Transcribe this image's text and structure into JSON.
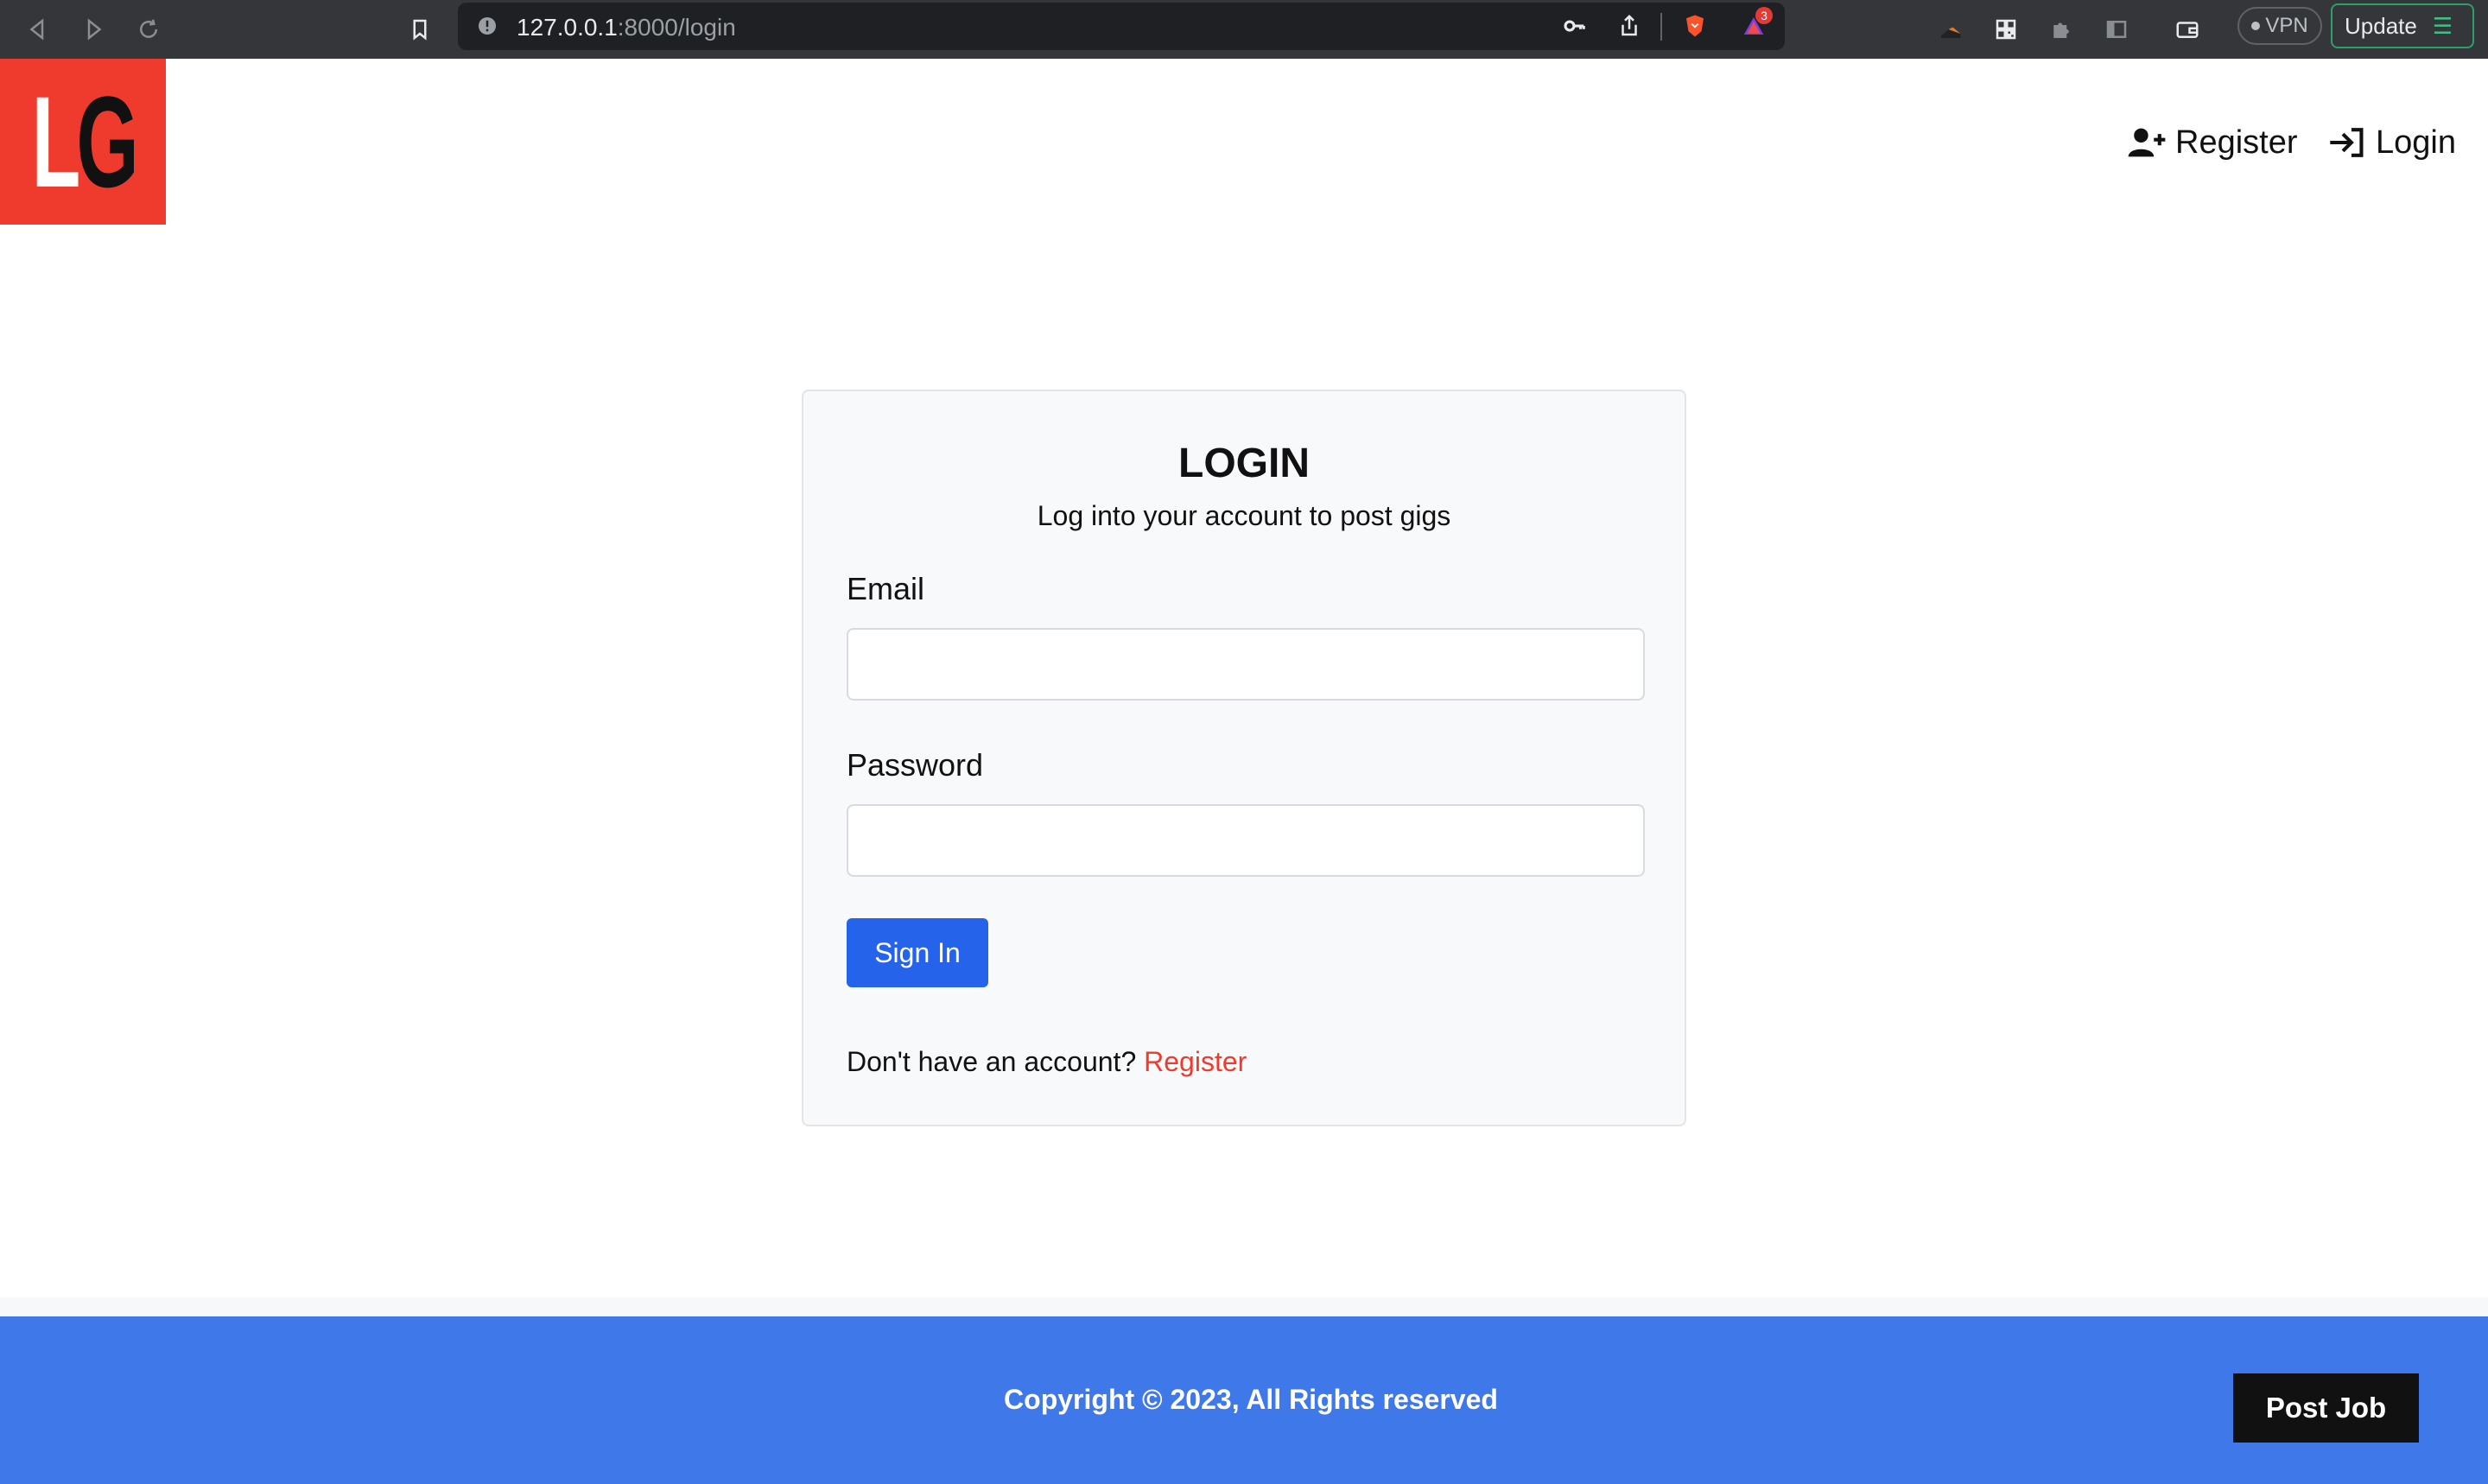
{
  "browser": {
    "url_host": "127.0.0.1",
    "url_rest": ":8000/login",
    "notification_count": "3",
    "vpn_label": "VPN",
    "update_label": "Update"
  },
  "header": {
    "logo_letters": [
      "L",
      "G"
    ],
    "nav": [
      {
        "label": "Register",
        "icon": "user-plus-icon"
      },
      {
        "label": "Login",
        "icon": "sign-in-icon"
      }
    ]
  },
  "login": {
    "title": "LOGIN",
    "subtitle": "Log into your account to post gigs",
    "email_label": "Email",
    "email_value": "",
    "password_label": "Password",
    "password_value": "",
    "submit_label": "Sign In",
    "register_prompt": "Don't have an account?",
    "register_link": "Register"
  },
  "footer": {
    "copyright": "Copyright © 2023, All Rights reserved",
    "post_job_label": "Post Job"
  },
  "colors": {
    "brand_red": "#ef3b2d",
    "primary_blue": "#2563eb",
    "footer_blue": "#3f78e8"
  }
}
